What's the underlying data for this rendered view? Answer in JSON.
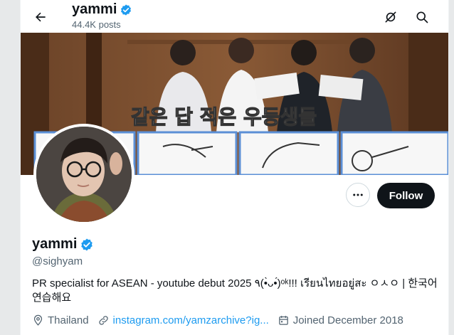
{
  "header": {
    "name": "yammi",
    "posts": "44.4K posts"
  },
  "banner": {
    "caption": "같은 답 적은 우등생들"
  },
  "profile": {
    "name": "yammi",
    "handle": "@sighyam",
    "bio": "PR specialist for ASEAN - youtube debut 2025 ٩(•̀ᴗ•́)ᵒᵏ!!! เรียนไทยอยู่สะ ㅇㅅㅇ | 한국어 연습해요",
    "location": "Thailand",
    "website": "instagram.com/yamzarchive?ig...",
    "joined": "Joined December 2018"
  },
  "buttons": {
    "follow": "Follow"
  },
  "colors": {
    "verified": "#1d9bf0",
    "follow_bg": "#0f1419",
    "link": "#1d9bf0",
    "muted": "#536471"
  },
  "icons": [
    "back-arrow-icon",
    "verified-badge-icon",
    "hide-icon",
    "search-icon",
    "more-icon",
    "location-icon",
    "link-icon",
    "calendar-icon"
  ]
}
